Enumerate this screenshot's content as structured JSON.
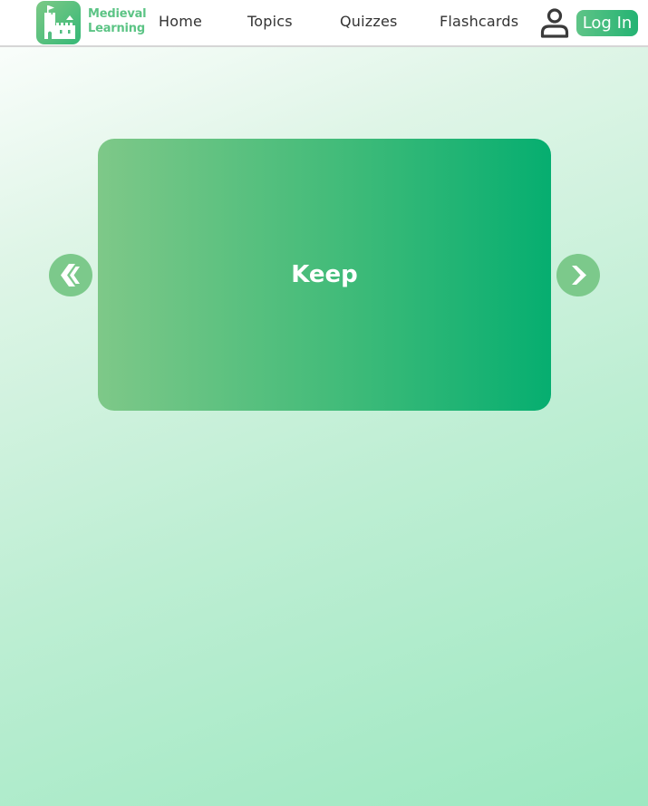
{
  "header": {
    "brand_line1": "Medieval",
    "brand_line2": "Learning",
    "nav": {
      "home": "Home",
      "topics": "Topics",
      "quizzes": "Quizzes",
      "flashcards": "Flashcards"
    },
    "login_label": "Log In",
    "icons": {
      "logo": "castle-logo-icon",
      "user": "user-icon"
    }
  },
  "flashcard": {
    "term": "Keep",
    "prev_icon": "chevron-left-icon",
    "next_icon": "chevron-right-icon"
  },
  "colors": {
    "brand_green": "#5cc485",
    "card_gradient_start": "#7ec888",
    "card_gradient_end": "#06ae70",
    "arrow_bg": "#7cc98b",
    "nav_text": "#333333"
  }
}
